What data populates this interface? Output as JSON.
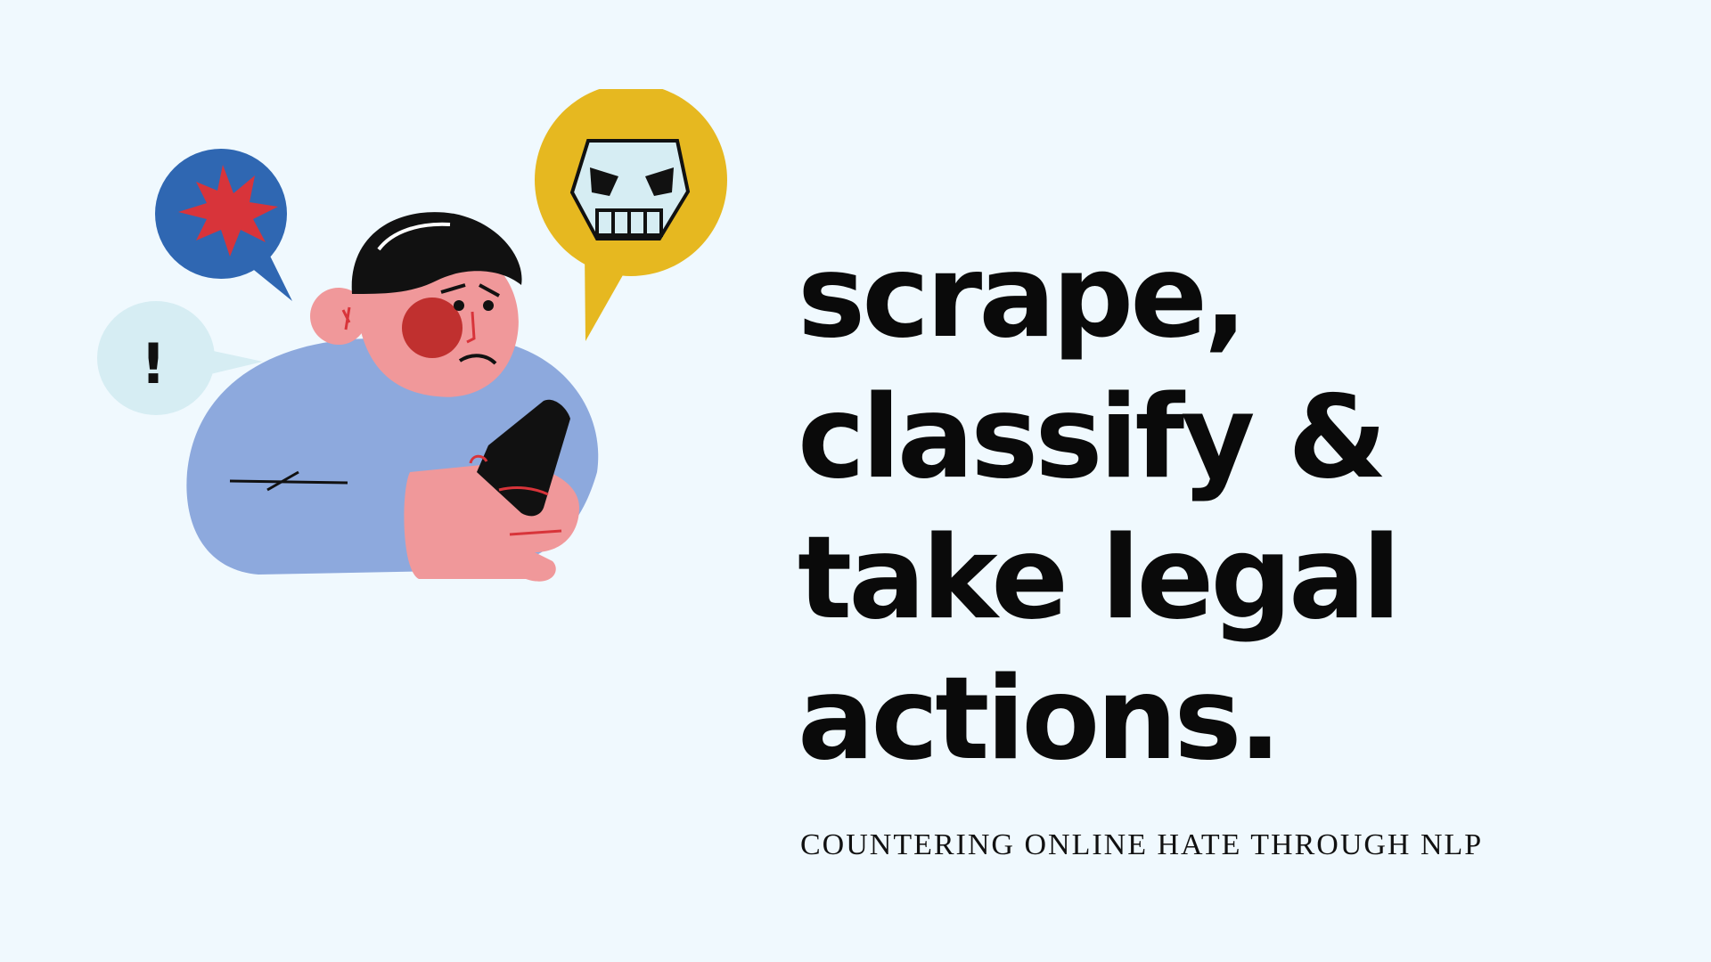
{
  "headline": {
    "lines": [
      "scrape,",
      "classify &",
      "take legal",
      "actions."
    ]
  },
  "subtitle": "COUNTERING ONLINE HATE THROUGH NLP",
  "illustration": {
    "bubble_exclamation_text": "!",
    "icons": [
      "starburst-icon",
      "exclamation-icon",
      "skull-icon",
      "smartphone-icon"
    ]
  },
  "colors": {
    "background": "#f0f9fe",
    "text": "#0a0a0a",
    "bubble_blue": "#2f67b2",
    "bubble_yellow": "#e6b820",
    "bubble_light": "#d6edf3",
    "burst_red": "#d8343a",
    "sweater": "#8da9dd",
    "skin": "#f0989a"
  }
}
